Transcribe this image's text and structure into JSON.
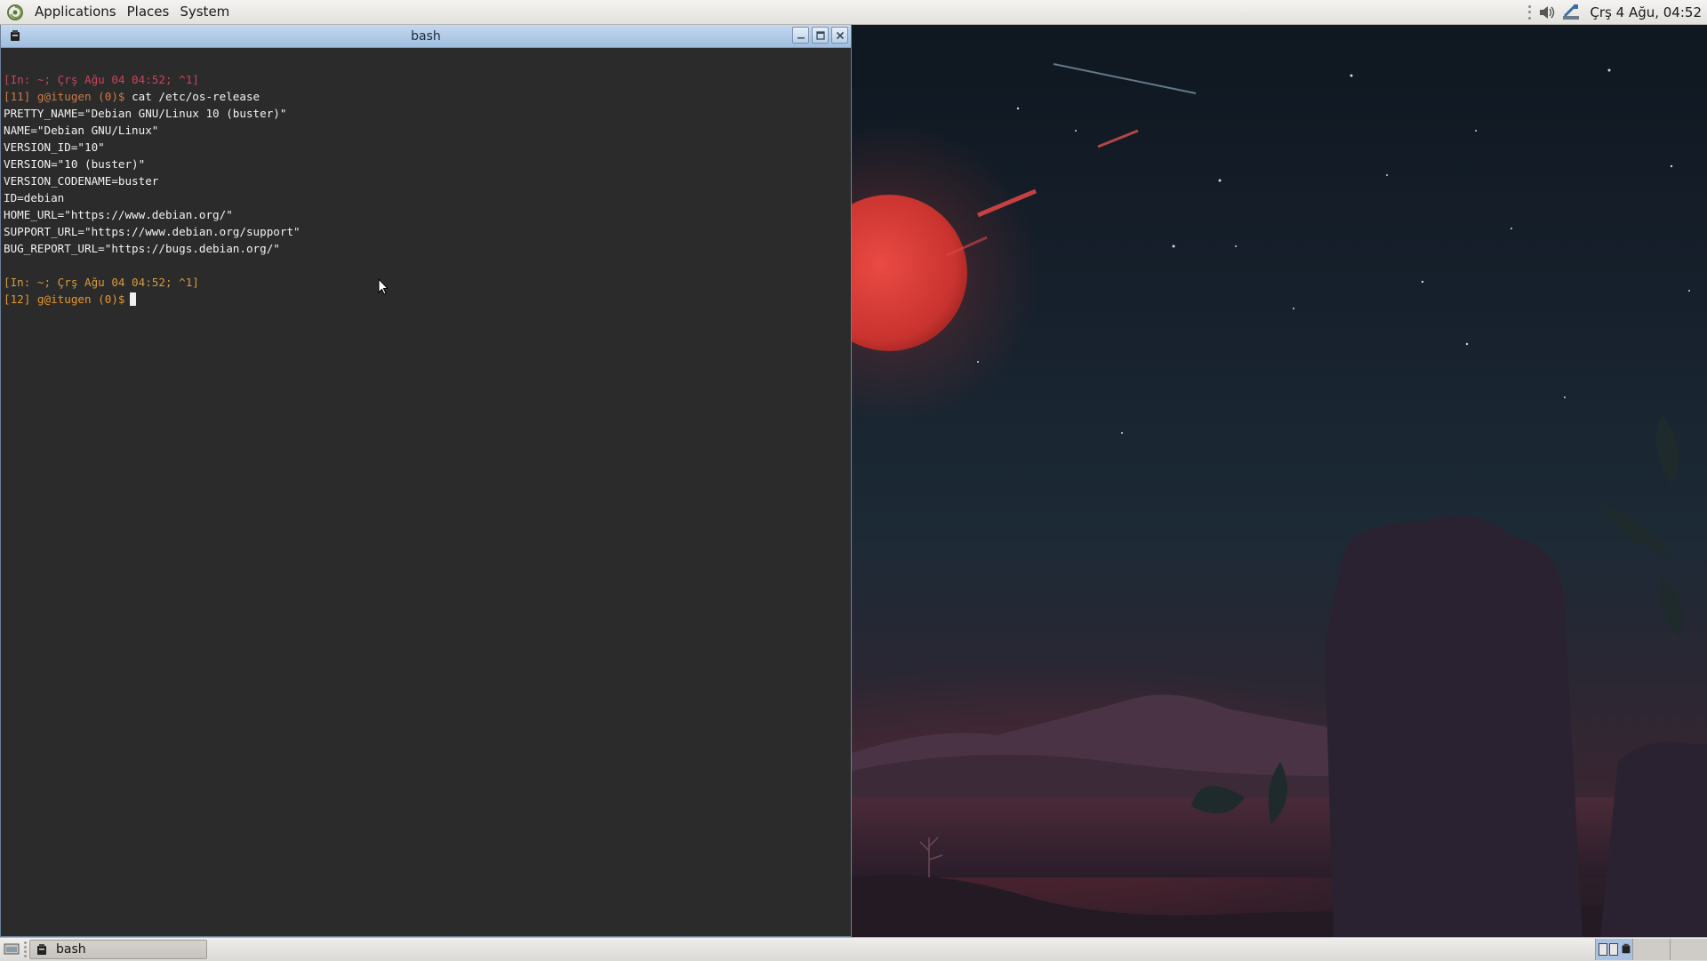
{
  "top_panel": {
    "menus": [
      "Applications",
      "Places",
      "System"
    ],
    "clock": "Çrş 4 Ağu, 04:52"
  },
  "window": {
    "title": "bash"
  },
  "terminal": {
    "lines": [
      {
        "segments": [
          {
            "text": "[In: ~; Çrş Ağu 04 04:52; ^1]",
            "cls": "c-meta"
          }
        ]
      },
      {
        "segments": [
          {
            "text": "[11] g@itugen (0)$",
            "cls": "c-prompt"
          },
          {
            "text": " cat /etc/os-release",
            "cls": ""
          }
        ]
      },
      {
        "segments": [
          {
            "text": "PRETTY_NAME=\"Debian GNU/Linux 10 (buster)\"",
            "cls": ""
          }
        ]
      },
      {
        "segments": [
          {
            "text": "NAME=\"Debian GNU/Linux\"",
            "cls": ""
          }
        ]
      },
      {
        "segments": [
          {
            "text": "VERSION_ID=\"10\"",
            "cls": ""
          }
        ]
      },
      {
        "segments": [
          {
            "text": "VERSION=\"10 (buster)\"",
            "cls": ""
          }
        ]
      },
      {
        "segments": [
          {
            "text": "VERSION_CODENAME=buster",
            "cls": ""
          }
        ]
      },
      {
        "segments": [
          {
            "text": "ID=debian",
            "cls": ""
          }
        ]
      },
      {
        "segments": [
          {
            "text": "HOME_URL=\"https://www.debian.org/\"",
            "cls": ""
          }
        ]
      },
      {
        "segments": [
          {
            "text": "SUPPORT_URL=\"https://www.debian.org/support\"",
            "cls": ""
          }
        ]
      },
      {
        "segments": [
          {
            "text": "BUG_REPORT_URL=\"https://bugs.debian.org/\"",
            "cls": ""
          }
        ]
      },
      {
        "segments": []
      },
      {
        "segments": [
          {
            "text": "[In: ~; Çrş Ağu 04 04:52; ^1]",
            "cls": "c-meta2"
          }
        ]
      },
      {
        "segments": [
          {
            "text": "[12] g@itugen (0)$",
            "cls": "c-prompt2"
          }
        ],
        "cursor": true
      }
    ]
  },
  "taskbar": {
    "task_label": "bash"
  },
  "icons": {
    "logo": "debian-swirl-icon",
    "volume": "volume-icon",
    "network": "network-icon",
    "terminal": "terminal-icon"
  },
  "colors": {
    "terminal_bg": "#2b2b2b",
    "titlebar": "#b3cbe7",
    "moon": "#d8403a"
  }
}
